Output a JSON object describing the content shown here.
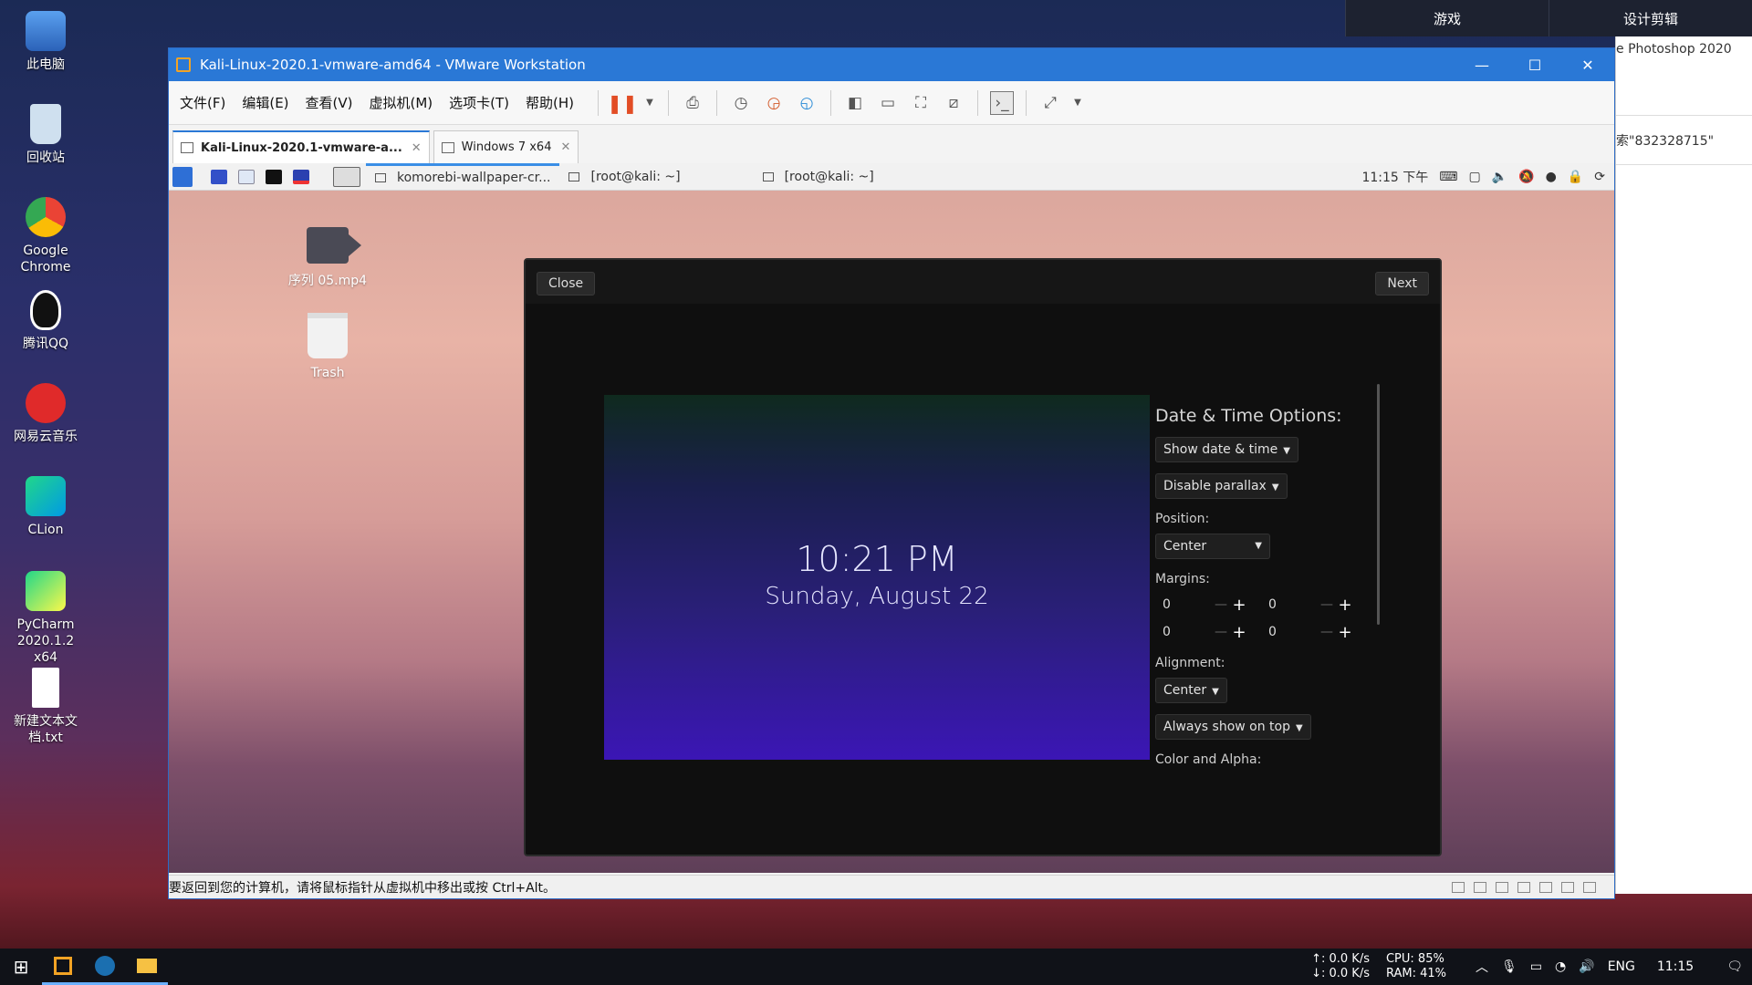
{
  "host_desktop": {
    "icons": [
      {
        "label": "此电脑",
        "icon": "computer-icon"
      },
      {
        "label": "回收站",
        "icon": "recycle-bin-icon"
      },
      {
        "label": "Google Chrome",
        "icon": "chrome-icon"
      },
      {
        "label": "腾讯QQ",
        "icon": "qq-icon"
      },
      {
        "label": "网易云音乐",
        "icon": "netease-music-icon"
      },
      {
        "label": "CLion",
        "icon": "clion-icon"
      },
      {
        "label": "PyCharm 2020.1.2 x64",
        "icon": "pycharm-icon"
      },
      {
        "label": "新建文本文档.txt",
        "icon": "text-file-icon"
      }
    ],
    "top_tabs": [
      "游戏",
      "设计剪辑"
    ],
    "right_pane": {
      "line1": "e Photoshop 2020",
      "line2": "索\"832328715\""
    }
  },
  "vmware": {
    "title": "Kali-Linux-2020.1-vmware-amd64 - VMware Workstation",
    "menu": [
      "文件(F)",
      "编辑(E)",
      "查看(V)",
      "虚拟机(M)",
      "选项卡(T)",
      "帮助(H)"
    ],
    "tabs": [
      {
        "label": "Kali-Linux-2020.1-vmware-a...",
        "active": true
      },
      {
        "label": "Windows 7 x64",
        "active": false
      }
    ],
    "status": "要返回到您的计算机，请将鼠标指针从虚拟机中移出或按 Ctrl+Alt。"
  },
  "guest": {
    "panel": {
      "tasks": [
        "komorebi-wallpaper-cr...",
        "[root@kali: ~]",
        "[root@kali: ~]"
      ],
      "clock": "11:15 下午"
    },
    "desktop_icons": [
      {
        "label": "序列 05.mp4",
        "icon": "video-file-icon"
      },
      {
        "label": "Trash",
        "icon": "trash-icon"
      }
    ],
    "dialog": {
      "close_label": "Close",
      "next_label": "Next",
      "preview_time": "10:21 PM",
      "preview_date": "Sunday, August 22",
      "options_title": "Date & Time Options:",
      "show_date_time": "Show date & time",
      "parallax": "Disable parallax",
      "position_label": "Position:",
      "position_value": "Center",
      "margins_label": "Margins:",
      "margins": [
        "0",
        "0",
        "0",
        "0"
      ],
      "alignment_label": "Alignment:",
      "alignment_value": "Center",
      "always_on_top": "Always show on top",
      "color_alpha_label": "Color and Alpha:"
    }
  },
  "taskbar": {
    "net_up": "↑: 0.0 K/s",
    "net_down": "↓: 0.0 K/s",
    "cpu": "CPU: 85%",
    "ram": "RAM: 41%",
    "lang": "ENG",
    "time": "11:15"
  },
  "colors": {
    "vmware_title": "#2a78d6",
    "preview_bottom": "#3b16b5",
    "pause": "#e24d25"
  }
}
